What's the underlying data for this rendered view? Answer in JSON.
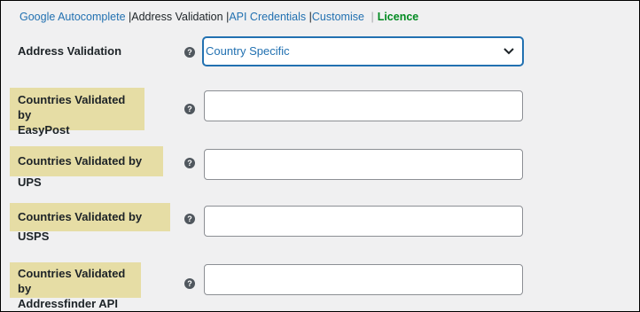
{
  "tabs": {
    "google_autocomplete": "Google Autocomplete",
    "address_validation": "Address Validation",
    "api_credentials": "API Credentials",
    "customise": "Customise",
    "licence": "Licence"
  },
  "fields": {
    "address_validation": {
      "label": "Address Validation",
      "selected": "Country Specific"
    },
    "easypost": {
      "label_line1": "Countries Validated by",
      "label_line2": "EasyPost",
      "value": ""
    },
    "ups": {
      "label": "Countries Validated by UPS",
      "value": ""
    },
    "usps": {
      "label": "Countries Validated by USPS",
      "value": ""
    },
    "addressfinder": {
      "label_line1": "Countries Validated by",
      "label_line2": "Addressfinder API",
      "value": ""
    }
  },
  "help_glyph": "?",
  "colors": {
    "link": "#2271b1",
    "licence": "#008a20",
    "highlight": "#e6dda5",
    "background": "#f0f0f1"
  }
}
